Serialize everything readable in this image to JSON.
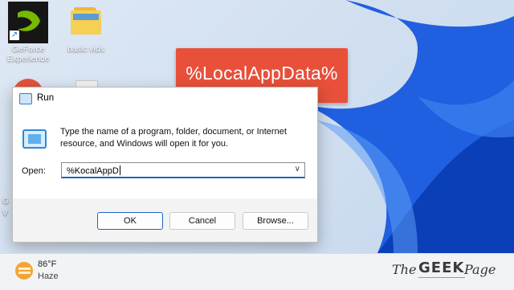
{
  "desktop": {
    "icons": [
      {
        "label_line1": "GeForce",
        "label_line2": "Experience"
      },
      {
        "label_line1": "basic vids",
        "label_line2": ""
      }
    ],
    "side_fragments": [
      "G",
      "V"
    ]
  },
  "callout": {
    "text": "%LocalAppData%"
  },
  "run_dialog": {
    "title": "Run",
    "description": "Type the name of a program, folder, document, or Internet resource, and Windows will open it for you.",
    "open_label": "Open:",
    "open_value": "%KocalAppD",
    "buttons": {
      "ok": "OK",
      "cancel": "Cancel",
      "browse": "Browse..."
    }
  },
  "taskbar": {
    "weather": {
      "temperature": "86°F",
      "condition": "Haze"
    }
  },
  "watermark": {
    "the": "The",
    "geek": "GEEK",
    "page": "Page"
  },
  "colors": {
    "callout": "#e8503a",
    "accent": "#1a66c7",
    "wallpaper_blue": "#1f5fe0"
  }
}
